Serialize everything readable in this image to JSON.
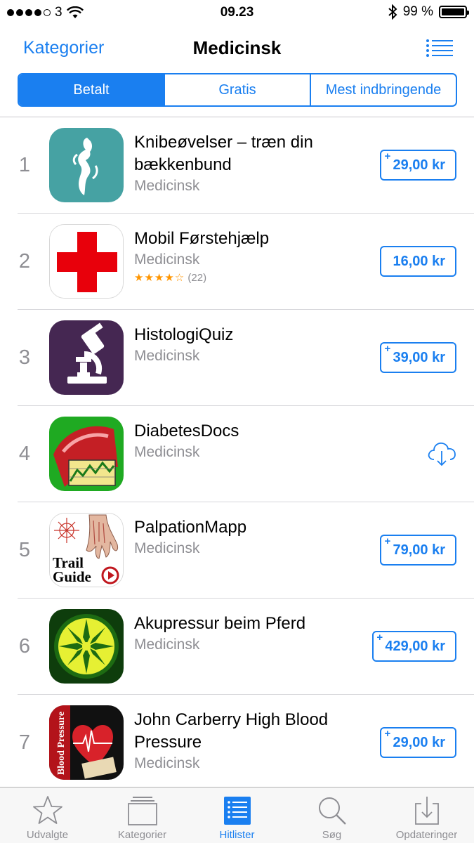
{
  "status_bar": {
    "carrier": "3",
    "time": "09.23",
    "battery": "99 %",
    "battery_level": 0.99
  },
  "nav": {
    "back_label": "Kategorier",
    "title": "Medicinsk"
  },
  "segments": [
    {
      "label": "Betalt",
      "active": true
    },
    {
      "label": "Gratis",
      "active": false
    },
    {
      "label": "Mest indbringende",
      "active": false
    }
  ],
  "apps": [
    {
      "rank": "1",
      "name": "Knibeøvelser – træn din bækkenbund",
      "category": "Medicinsk",
      "price": "29,00 kr",
      "plus": "+",
      "icon": "pelvic-figure-icon"
    },
    {
      "rank": "2",
      "name": "Mobil Førstehjælp",
      "category": "Medicinsk",
      "rating_stars": "★★★★☆",
      "rating_count": "(22)",
      "rating": 4,
      "price": "16,00 kr",
      "plus": "",
      "icon": "red-cross-icon"
    },
    {
      "rank": "3",
      "name": "HistologiQuiz",
      "category": "Medicinsk",
      "price": "39,00 kr",
      "plus": "+",
      "icon": "microscope-icon"
    },
    {
      "rank": "4",
      "name": "DiabetesDocs",
      "category": "Medicinsk",
      "action": "download",
      "icon": "diabetes-chart-icon"
    },
    {
      "rank": "5",
      "name": "PalpationMapp",
      "category": "Medicinsk",
      "price": "79,00 kr",
      "plus": "+",
      "icon": "trail-guide-icon",
      "icon_text": {
        "line1": "Trail",
        "line2": "Guide"
      }
    },
    {
      "rank": "6",
      "name": "Akupressur beim Pferd",
      "category": "Medicinsk",
      "price": "429,00 kr",
      "plus": "+",
      "icon": "horse-acupressure-icon"
    },
    {
      "rank": "7",
      "name": "John Carberry High Blood Pressure",
      "category": "Medicinsk",
      "price": "29,00 kr",
      "plus": "+",
      "icon": "blood-pressure-icon",
      "icon_text": {
        "vertical": "Blood Pressure"
      }
    }
  ],
  "tabs": [
    {
      "label": "Udvalgte",
      "icon": "star-icon",
      "active": false
    },
    {
      "label": "Kategorier",
      "icon": "stack-icon",
      "active": false
    },
    {
      "label": "Hitlister",
      "icon": "ranked-list-icon",
      "active": true
    },
    {
      "label": "Søg",
      "icon": "search-icon",
      "active": false
    },
    {
      "label": "Opdateringer",
      "icon": "download-tray-icon",
      "active": false
    }
  ],
  "colors": {
    "accent": "#1a7ff0",
    "secondary_text": "#8e8e93",
    "rating_star": "#ff9500"
  }
}
